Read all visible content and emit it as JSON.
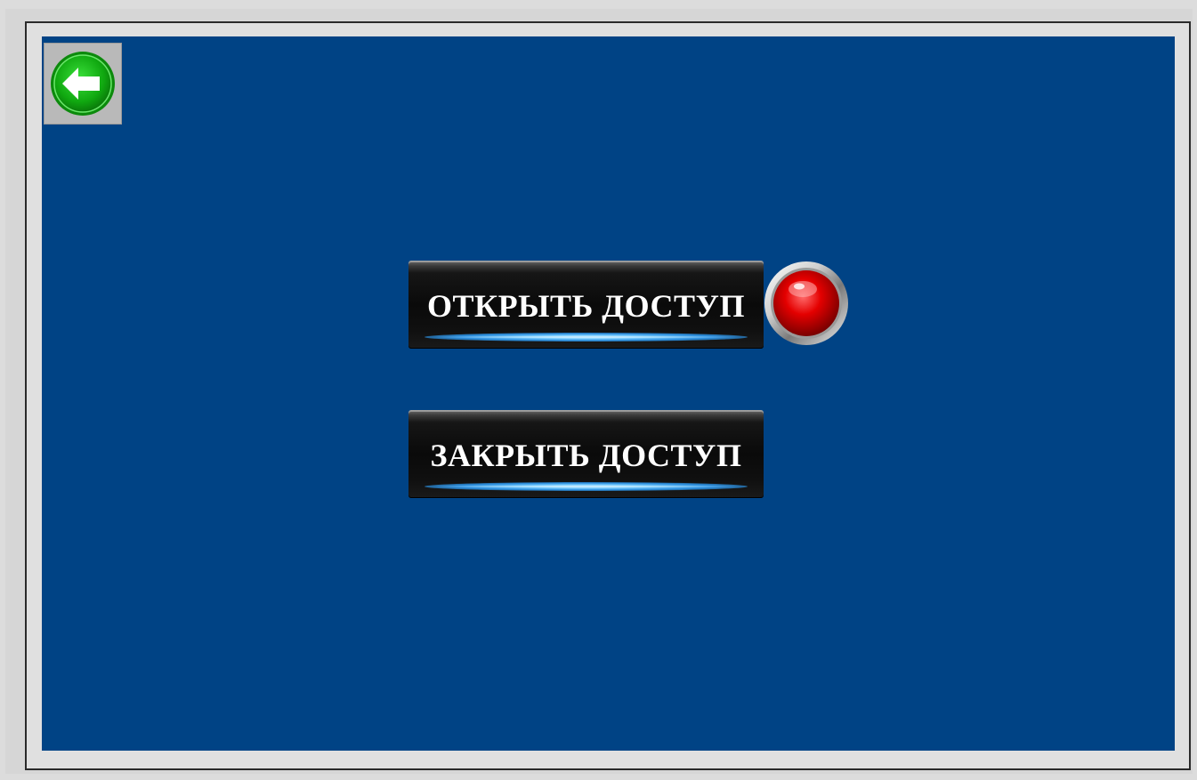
{
  "buttons": {
    "open_access": "ОТКРЫТЬ ДОСТУП",
    "close_access": "ЗАКРЫТЬ ДОСТУП"
  },
  "navigation": {
    "back_icon": "arrow-left-icon"
  },
  "indicator": {
    "state": "off",
    "color": "#e00000"
  },
  "colors": {
    "screen_background": "#004385",
    "back_button": "#22b022",
    "button_glow": "#4fb4ff"
  }
}
